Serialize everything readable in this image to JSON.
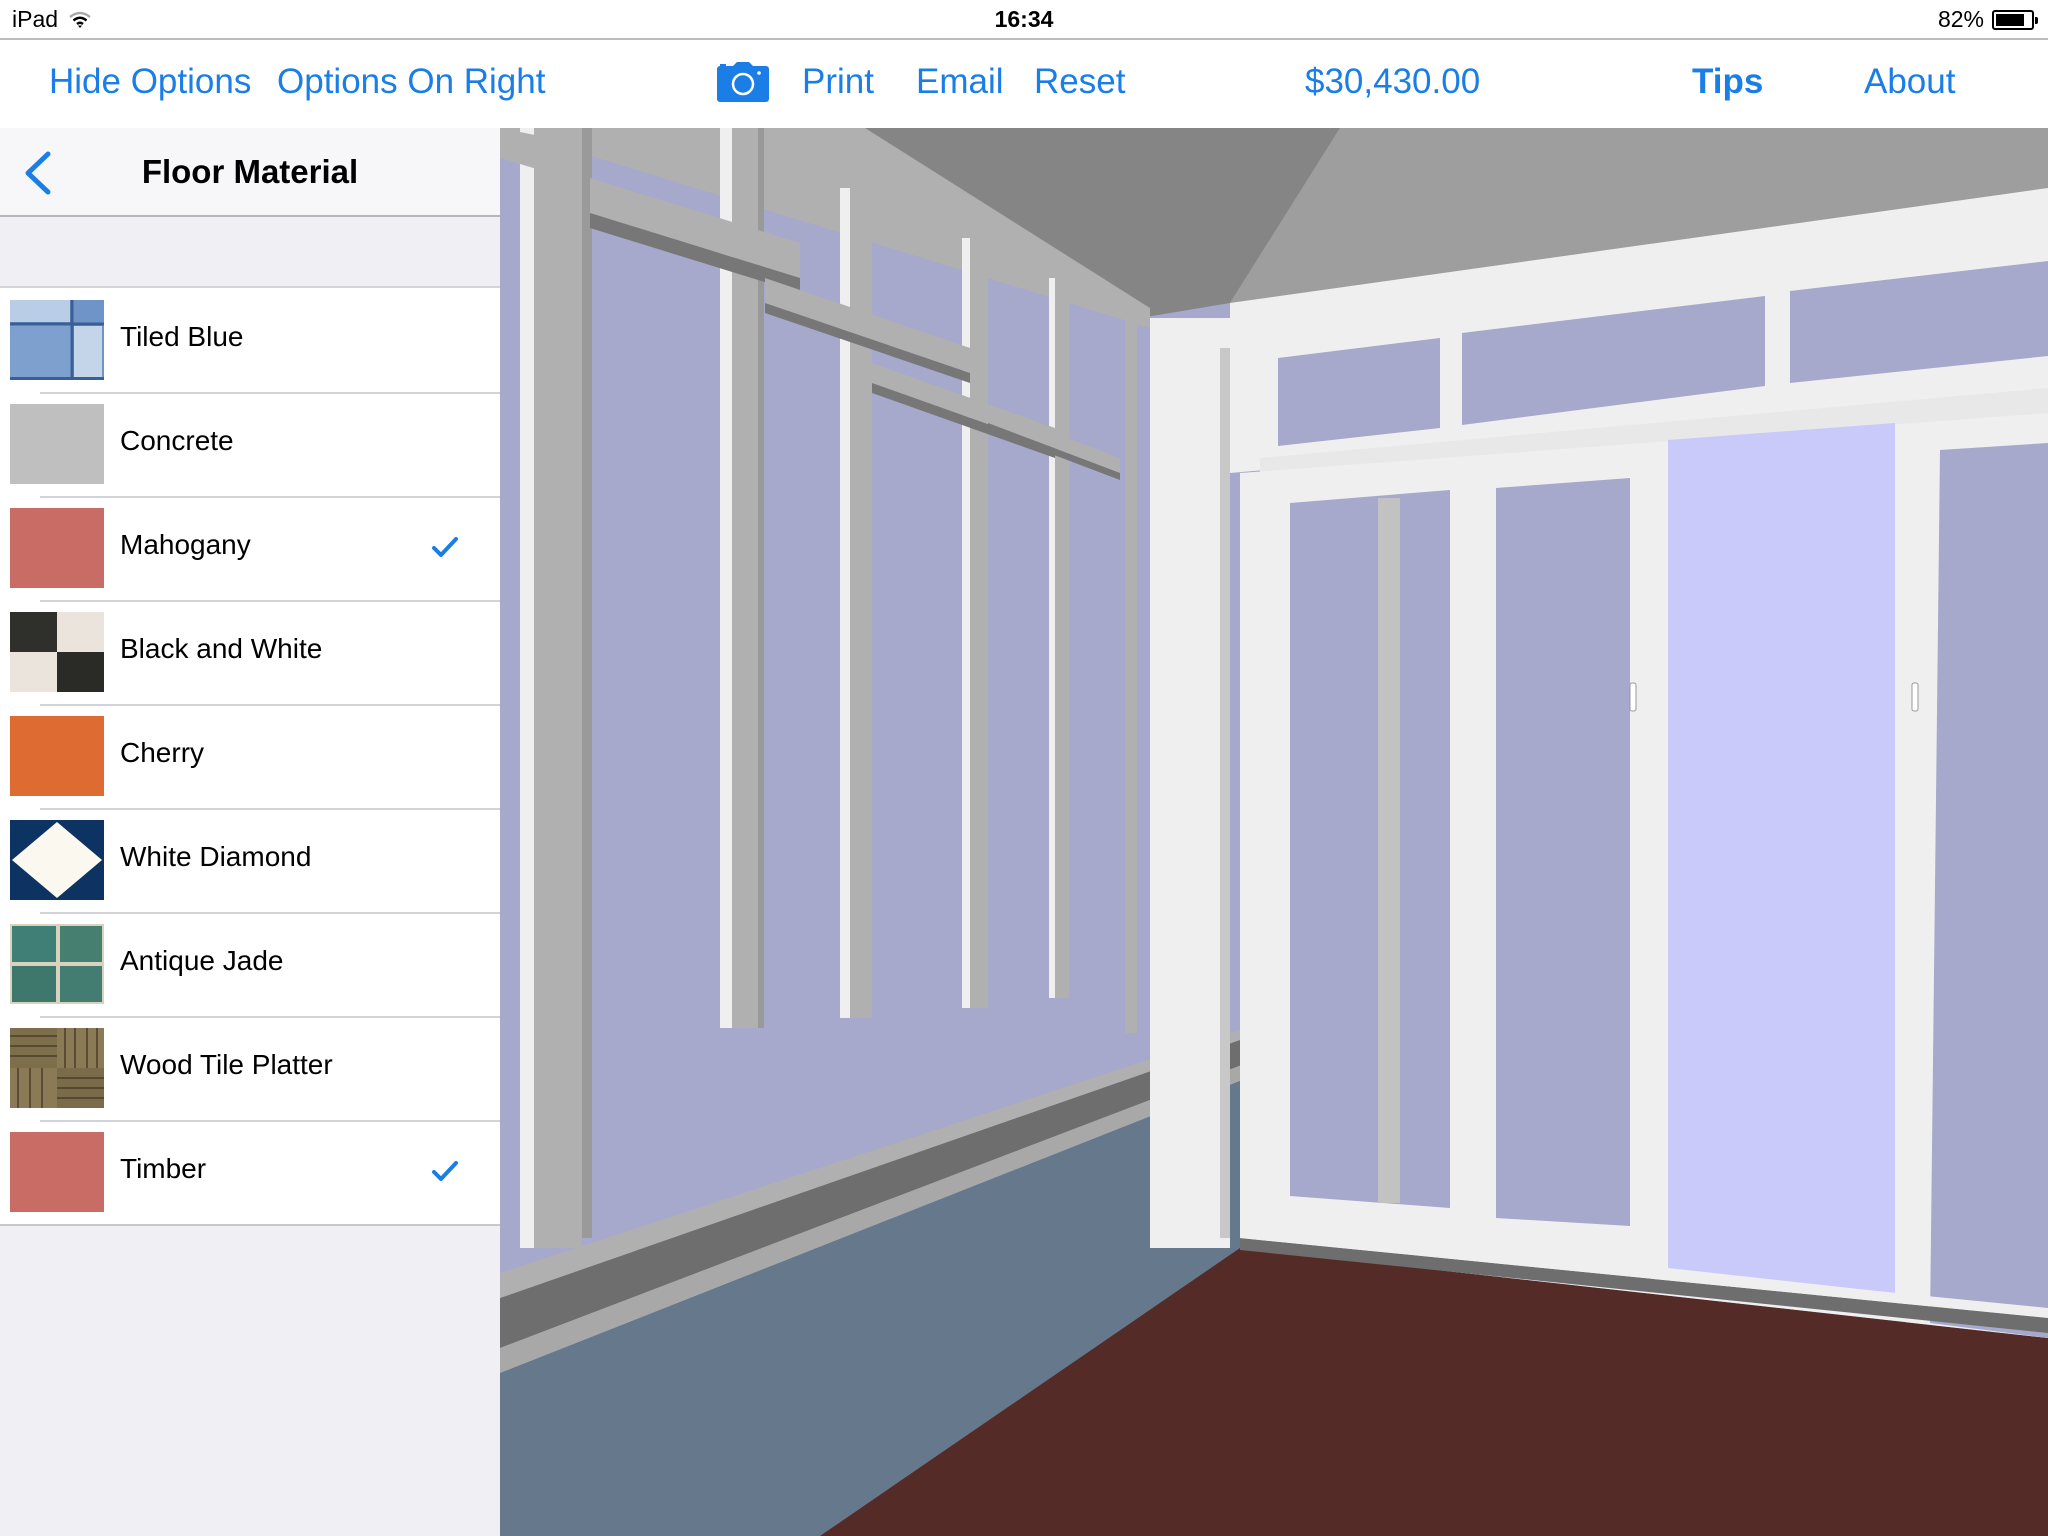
{
  "status_bar": {
    "device": "iPad",
    "time": "16:34",
    "battery_percent_label": "82%",
    "battery_level": 0.82,
    "wifi_icon": "wifi-icon",
    "battery_icon": "battery-icon"
  },
  "toolbar": {
    "hide_options": "Hide Options",
    "options_on_right": "Options On Right",
    "camera_icon": "camera-icon",
    "print": "Print",
    "email": "Email",
    "reset": "Reset",
    "price": "$30,430.00",
    "tips": "Tips",
    "about": "About",
    "accent_color": "#1a7ee6"
  },
  "sidebar": {
    "back_icon": "chevron-left-icon",
    "title": "Floor Material",
    "items": [
      {
        "label": "Tiled Blue",
        "swatch": "tiled-blue",
        "checked": false
      },
      {
        "label": "Concrete",
        "swatch": "concrete",
        "checked": false
      },
      {
        "label": "Mahogany",
        "swatch": "mahogany",
        "checked": true
      },
      {
        "label": "Black and White",
        "swatch": "black-and-white",
        "checked": false
      },
      {
        "label": "Cherry",
        "swatch": "cherry",
        "checked": false
      },
      {
        "label": "White Diamond",
        "swatch": "white-diamond",
        "checked": false
      },
      {
        "label": "Antique Jade",
        "swatch": "antique-jade",
        "checked": false
      },
      {
        "label": "Wood Tile Platter",
        "swatch": "wood-tile-platter",
        "checked": false
      },
      {
        "label": "Timber",
        "swatch": "timber",
        "checked": true
      }
    ]
  },
  "scene": {
    "description": "3D sunroom preview",
    "colors": {
      "glass": "#a6a8cc",
      "glass_light": "#cacafa",
      "frame_white": "#efefef",
      "frame_gray": "#b0b0b0",
      "knee_wall": "#66798c",
      "floor": "#552b28",
      "ceiling_dark": "#858585",
      "ceiling_light": "#9e9e9e"
    }
  }
}
